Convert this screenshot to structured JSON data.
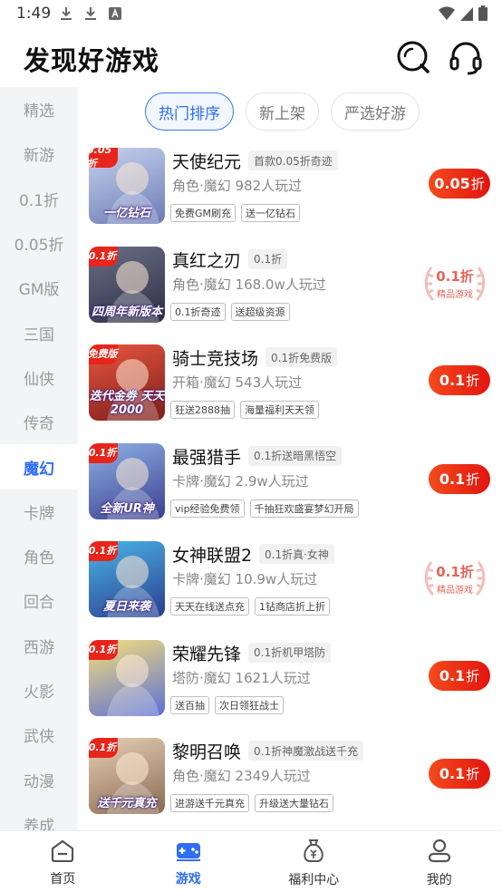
{
  "status_bar": {
    "time": "1:49"
  },
  "header": {
    "title": "发现好游戏"
  },
  "sidebar": {
    "items": [
      {
        "label": "精选"
      },
      {
        "label": "新游"
      },
      {
        "label": "0.1折"
      },
      {
        "label": "0.05折"
      },
      {
        "label": "GM版"
      },
      {
        "label": "三国"
      },
      {
        "label": "仙侠"
      },
      {
        "label": "传奇"
      },
      {
        "label": "魔幻",
        "active": true
      },
      {
        "label": "卡牌"
      },
      {
        "label": "角色"
      },
      {
        "label": "回合"
      },
      {
        "label": "西游"
      },
      {
        "label": "火影"
      },
      {
        "label": "武侠"
      },
      {
        "label": "动漫"
      },
      {
        "label": "养成"
      }
    ]
  },
  "tabs": [
    {
      "label": "热门排序",
      "active": true
    },
    {
      "label": "新上架"
    },
    {
      "label": "严选好游"
    }
  ],
  "games": [
    {
      "name": "天使纪元",
      "badge": "首款0.05折奇迹",
      "meta": "角色·魔幻  982人玩过",
      "tags": [
        "免费GM刷充",
        "送一亿钻石"
      ],
      "action": "button",
      "discount": "0.05",
      "unit": "折",
      "thumb_text": "一亿钻石",
      "corner": "0.05折",
      "colors": [
        "#c9d3ee",
        "#6a7bb5"
      ]
    },
    {
      "name": "真红之刃",
      "badge": "0.1折",
      "meta": "角色·魔幻  168.0w人玩过",
      "tags": [
        "0.1折奇迹",
        "送超级资源"
      ],
      "action": "seal",
      "discount": "0.1折",
      "seal_sub": "精品游戏",
      "thumb_text": "四周年新版本",
      "corner": "0.1折",
      "colors": [
        "#6b6f86",
        "#2c2f45"
      ]
    },
    {
      "name": "骑士竞技场",
      "badge": "0.1折免费版",
      "meta": "开箱·魔幻  543人玩过",
      "tags": [
        "狂送2888抽",
        "海量福利天天领"
      ],
      "action": "button",
      "discount": "0.1",
      "unit": "折",
      "thumb_text": "迭代金劵 天天2000",
      "corner": "免费版",
      "colors": [
        "#e9573f",
        "#7a1d1a"
      ]
    },
    {
      "name": "最强猎手",
      "badge": "0.1折送暗黑悟空",
      "meta": "卡牌·魔幻  2.9w人玩过",
      "tags": [
        "vip经验免费领",
        "千抽狂欢盛宴梦幻开局"
      ],
      "action": "button",
      "discount": "0.1",
      "unit": "折",
      "thumb_text": "全新UR神",
      "corner": "0.1折",
      "colors": [
        "#8fb2e6",
        "#3b3f8f"
      ]
    },
    {
      "name": "女神联盟2",
      "badge": "0.1折真·女神",
      "meta": "卡牌·魔幻  10.9w人玩过",
      "tags": [
        "天天在线送点充",
        "1钻商店折上折"
      ],
      "action": "seal",
      "discount": "0.1折",
      "seal_sub": "精品游戏",
      "thumb_text": "夏日来袭",
      "corner": "0.1折",
      "colors": [
        "#4bb5e6",
        "#2a3e8e"
      ]
    },
    {
      "name": "荣耀先锋",
      "badge": "0.1折机甲塔防",
      "meta": "塔防·魔幻  1621人玩过",
      "tags": [
        "送百抽",
        "次日领狂战士"
      ],
      "action": "button",
      "discount": "0.1",
      "unit": "折",
      "thumb_text": "",
      "corner": "0.1折",
      "colors": [
        "#f7e07a",
        "#5b6fd6"
      ]
    },
    {
      "name": "黎明召唤",
      "badge": "0.1折神魔激战送千充",
      "meta": "角色·魔幻  2349人玩过",
      "tags": [
        "进游送千元真充",
        "升级送大量钻石"
      ],
      "action": "button",
      "discount": "0.1",
      "unit": "折",
      "thumb_text": "送千元真充",
      "corner": "0.1折",
      "colors": [
        "#e8d0b8",
        "#8a6a50"
      ]
    }
  ],
  "bottom_nav": [
    {
      "label": "首页",
      "icon": "home-icon"
    },
    {
      "label": "游戏",
      "icon": "gamepad-icon",
      "active": true
    },
    {
      "label": "福利中心",
      "icon": "money-bag-icon"
    },
    {
      "label": "我的",
      "icon": "user-icon"
    }
  ]
}
